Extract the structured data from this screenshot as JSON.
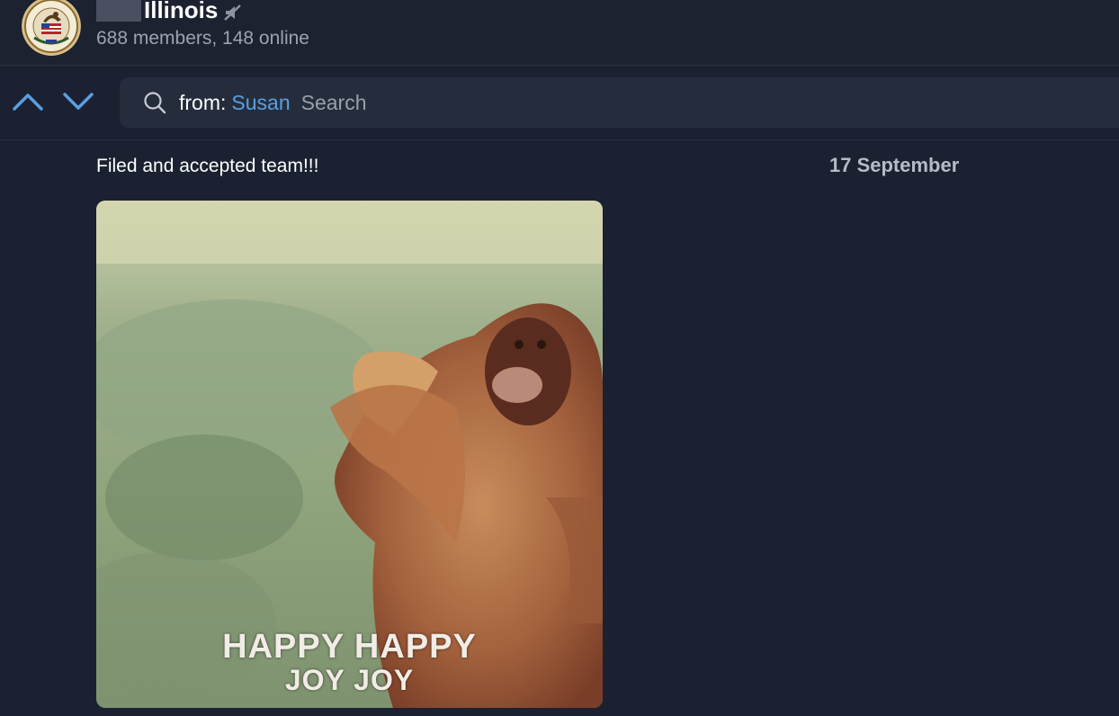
{
  "header": {
    "title": "Illinois",
    "subtitle": "688 members, 148 online",
    "avatar_icon": "illinois-seal-icon",
    "muted_icon": "muted-icon"
  },
  "search": {
    "from_label": "from:",
    "user_filter": "Susan",
    "placeholder": "Search",
    "up_icon": "chevron-up-icon",
    "down_icon": "chevron-down-icon",
    "accent_color": "#5a9fe0"
  },
  "message": {
    "text": "Filed and accepted team!!!",
    "date": "17 September",
    "gif": {
      "caption_line1": "HAPPY HAPPY",
      "caption_line2": "JOY JOY"
    }
  }
}
